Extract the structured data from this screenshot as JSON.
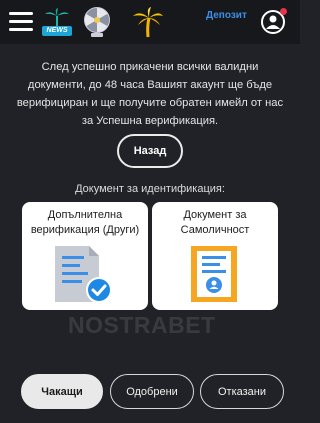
{
  "header": {
    "menu_icon": "hamburger-menu-icon",
    "news_badge": "NEWS",
    "wheel_icon": "fortune-wheel-icon",
    "palm_icon": "palm-tree-logo-icon",
    "deposit_label": "Депозит",
    "avatar_icon": "user-avatar-icon",
    "notification": "notification-dot"
  },
  "info_text": "След успешно прикачени всички валидни документи, до 48 часа Вашият акаунт ще бъде верифициран и ще получите обратен имейл от нас за Успешна верификация.",
  "back_button_label": "Назад",
  "section_label": "Документ за идентификация:",
  "cards": [
    {
      "title": "Допълнителна верификация (Други)",
      "icon": "document-check-icon"
    },
    {
      "title": "Документ за Самоличност",
      "icon": "id-document-icon"
    }
  ],
  "watermark": "NOSTRABET",
  "tabs": [
    {
      "label": "Чакащи",
      "active": true
    },
    {
      "label": "Одобрени",
      "active": false
    },
    {
      "label": "Отказани",
      "active": false
    }
  ],
  "colors": {
    "background": "#212227",
    "header": "#17181c",
    "accent_blue": "#3b8fe6",
    "check_blue": "#1e88e5",
    "doc_orange": "#f5a623",
    "notification_red": "#e8334a"
  }
}
